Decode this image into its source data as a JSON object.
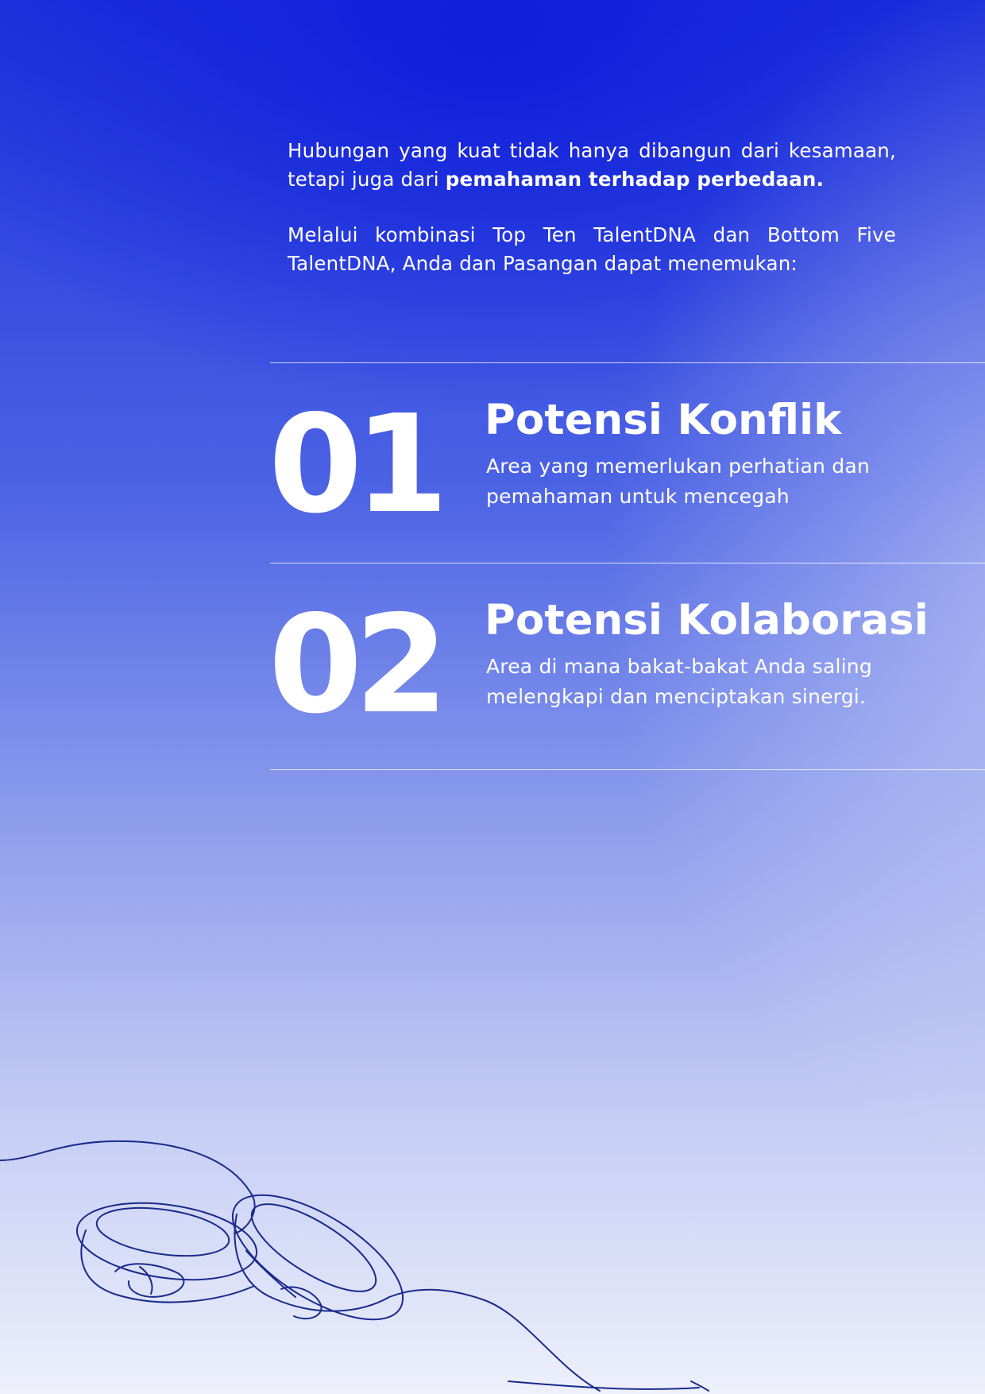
{
  "intro": {
    "paragraph1_plain": "Hubungan yang kuat tidak hanya dibangun dari kesamaan, tetapi juga dari ",
    "paragraph1_bold": "pemahaman terhadap perbedaan.",
    "paragraph2": "Melalui kombinasi Top Ten TalentDNA dan Bottom Five TalentDNA, Anda dan Pasangan dapat menemukan:"
  },
  "items": [
    {
      "number": "01",
      "title": "Potensi Konflik",
      "description": "Area yang memerlukan perhatian dan pemahaman untuk mencegah"
    },
    {
      "number": "02",
      "title": "Potensi Kolaborasi",
      "description": "Area di mana bakat-bakat Anda saling melengkapi dan menciptakan sinergi."
    }
  ],
  "colors": {
    "background_top": "#0f1cda",
    "background_bottom": "#f4f5fc",
    "text": "#ffffff",
    "line_art": "#1a2a8c"
  },
  "decoration": {
    "illustration": "wedding-rings-line-art"
  }
}
